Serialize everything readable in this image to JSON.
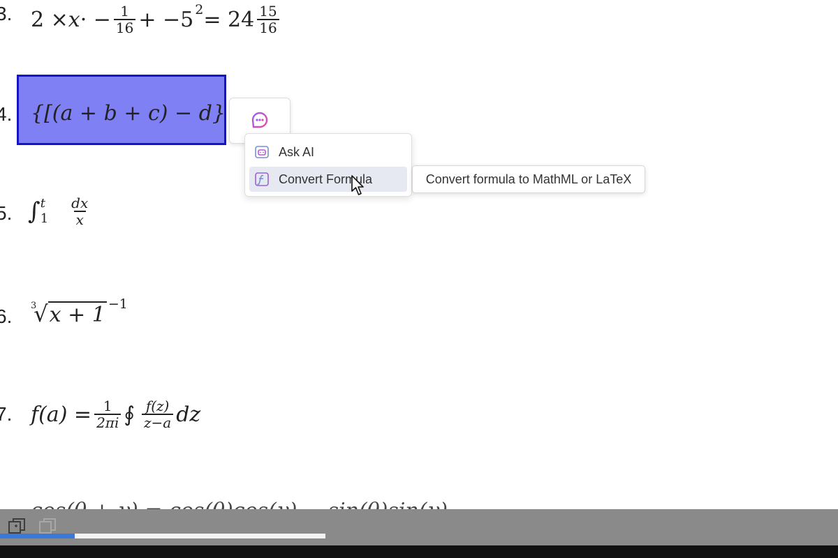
{
  "equations": {
    "eq3": {
      "number": "3.",
      "lead": "2 × ",
      "x": "x",
      "dot": " · −",
      "frac1_num": "1",
      "frac1_den": "16",
      "mid": " + −5",
      "exp": "2",
      "eqs": " = 24",
      "frac2_num": "15",
      "frac2_den": "16"
    },
    "eq4": {
      "number": "4.",
      "text": "{[(a + b + c) − d}"
    },
    "eq5": {
      "number": "5.",
      "integral": "∫",
      "upper": "t",
      "lower": "1",
      "num": "dx",
      "den": "x"
    },
    "eq6": {
      "number": "6.",
      "index": "3",
      "radical": "√",
      "radicand": "x + 1",
      "exp": "−1"
    },
    "eq7": {
      "number": "7.",
      "lhs": "f(a) = ",
      "frac1_num": "1",
      "frac1_den": "2πi",
      "oint": "∮",
      "frac2_num": "f(z)",
      "frac2_den": "z−a",
      "dz": "dz"
    },
    "eq8_partial": {
      "text": "cos(θ + γ) = cos(θ)cos(γ) − sin(θ)sin(γ)"
    }
  },
  "ai_chip": {
    "icon": "ai-assistant-icon"
  },
  "context_menu": {
    "items": [
      {
        "label": "Ask AI",
        "icon": "ask-ai-icon"
      },
      {
        "label": "Convert Formula",
        "icon": "function-icon"
      }
    ]
  },
  "tooltip": {
    "text": "Convert formula to MathML or LaTeX"
  },
  "taskbar": {
    "icons": [
      "window-copy-icon",
      "window-copy-disabled-icon"
    ],
    "progress": 0.23,
    "accent": "#3a79d9"
  },
  "colors": {
    "selection_fill": "#8080f5",
    "selection_border": "#1414c8",
    "menu_hover": "#e6e9f1"
  }
}
